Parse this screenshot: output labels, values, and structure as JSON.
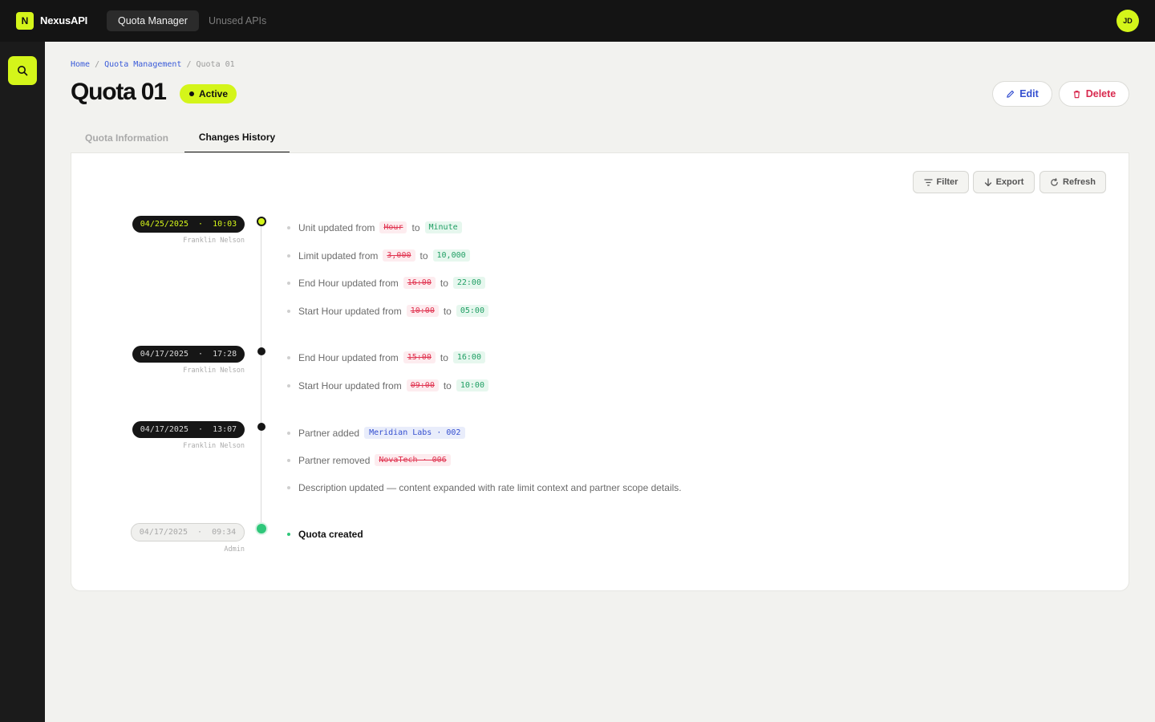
{
  "app": {
    "logo_letter": "N",
    "name": "NexusAPI",
    "nav": [
      "Quota Manager",
      "Unused APIs"
    ],
    "user_initials": "JD"
  },
  "sidebar": {
    "search_icon": "search-icon"
  },
  "breadcrumb": {
    "home": "Home",
    "sep": "/",
    "section": "Quota Management",
    "current": "Quota 01"
  },
  "page": {
    "title": "Quota 01",
    "status": "Active",
    "edit_label": "Edit",
    "delete_label": "Delete"
  },
  "tabs": [
    "Quota Information",
    "Changes History"
  ],
  "toolbar": {
    "filter": "Filter",
    "export": "Export",
    "refresh": "Refresh"
  },
  "history": [
    {
      "date": "04/25/2025  ·  10:03",
      "author": "Franklin Nelson",
      "changes": [
        {
          "label": "Unit updated from",
          "from": "Hour",
          "to_word": "to",
          "to": "Minute"
        },
        {
          "label": "Limit updated from",
          "from": "3,000",
          "to_word": "to",
          "to": "10,000"
        },
        {
          "label": "End Hour updated from",
          "from": "16:00",
          "to_word": "to",
          "to": "22:00"
        },
        {
          "label": "Start Hour updated from",
          "from": "10:00",
          "to_word": "to",
          "to": "05:00"
        }
      ]
    },
    {
      "date": "04/17/2025  ·  17:28",
      "author": "Franklin Nelson",
      "changes": [
        {
          "label": "End Hour updated from",
          "from": "15:00",
          "to_word": "to",
          "to": "16:00"
        },
        {
          "label": "Start Hour updated from",
          "from": "09:00",
          "to_word": "to",
          "to": "10:00"
        }
      ]
    },
    {
      "date": "04/17/2025  ·  13:07",
      "author": "Franklin Nelson",
      "changes": [
        {
          "label": "Partner added",
          "tag": "Meridian Labs · 002"
        },
        {
          "label": "Partner removed",
          "removed": "NovaTech · 006"
        },
        {
          "label": "Description updated — content expanded with rate limit context and partner scope details."
        }
      ]
    },
    {
      "date": "04/17/2025  ·  09:34",
      "author": "Admin",
      "changes": [
        {
          "label": "Quota created"
        }
      ]
    }
  ],
  "colors": {
    "accent": "#d4f51a",
    "removed": "#e0324f",
    "added": "#1f9e63",
    "link": "#3550d0"
  }
}
